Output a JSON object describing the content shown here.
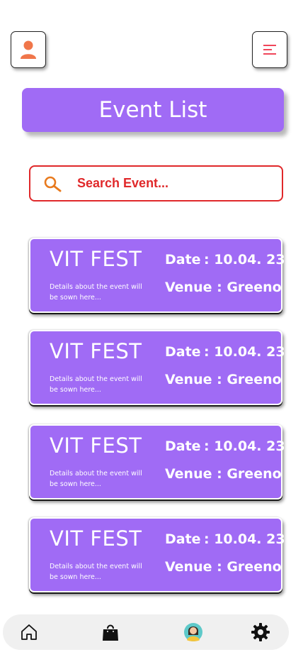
{
  "header": {
    "profile_icon": "user-icon",
    "menu_icon": "hamburger-menu-icon",
    "accent_icon_color": "#f0764a"
  },
  "title": "Event List",
  "search": {
    "placeholder": "Search Event..."
  },
  "events": [
    {
      "name": "VIT FEST",
      "description": "Details about the event will be sown here...",
      "date_label": "Date",
      "date_value": ": 10.04. 23",
      "venue_label": "Venue",
      "venue_value": ": Greeno"
    },
    {
      "name": "VIT FEST",
      "description": "Details about the event will be sown here...",
      "date_label": "Date",
      "date_value": ": 10.04. 23",
      "venue_label": "Venue",
      "venue_value": ": Greeno"
    },
    {
      "name": "VIT FEST",
      "description": "Details about the event will be sown here...",
      "date_label": "Date",
      "date_value": ": 10.04. 23",
      "venue_label": "Venue",
      "venue_value": ": Greeno"
    },
    {
      "name": "VIT FEST",
      "description": "Details about the event will be sown here...",
      "date_label": "Date",
      "date_value": ": 10.04. 23",
      "venue_label": "Venue",
      "venue_value": ": Greeno"
    }
  ],
  "bottom_nav": [
    "home-icon",
    "shopping-bag-icon",
    "avatar-icon",
    "settings-gear-icon"
  ],
  "colors": {
    "primary": "#a06bf5",
    "search_accent": "#e0282a",
    "nav_bg": "#f0f0f0"
  }
}
